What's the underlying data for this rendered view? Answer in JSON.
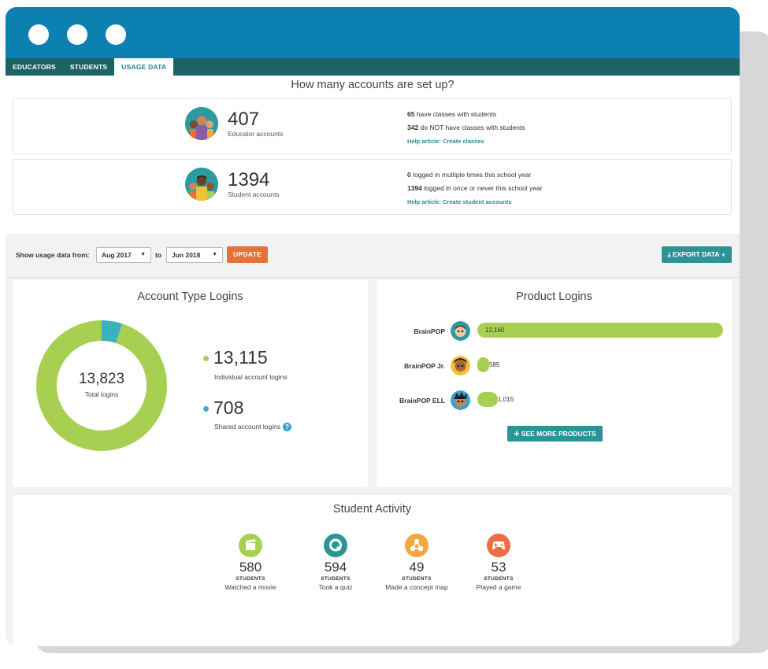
{
  "tabs": [
    {
      "label": "EDUCATORS"
    },
    {
      "label": "STUDENTS"
    },
    {
      "label": "USAGE DATA"
    }
  ],
  "accounts": {
    "title": "How many accounts are set up?",
    "educator": {
      "count": "407",
      "label": "Educator accounts",
      "line1_num": "65",
      "line1_text": " have classes with students",
      "line2_num": "342",
      "line2_text": " do NOT have classes with students",
      "help": "Help article: Create classes"
    },
    "student": {
      "count": "1394",
      "label": "Student accounts",
      "line1_num": "0",
      "line1_text": " logged in multiple times this school year",
      "line2_num": "1394",
      "line2_text": " logged in once or never this school year",
      "help": "Help article: Create student accounts"
    }
  },
  "filter": {
    "label": "Show usage data from:",
    "from": "Aug 2017",
    "to_label": "to",
    "to": "Jun 2018",
    "update": "UPDATE",
    "export": "EXPORT DATA"
  },
  "account_logins": {
    "title": "Account Type Logins",
    "total": "13,823",
    "total_label": "Total logins",
    "individual": "13,115",
    "individual_value": 13115,
    "individual_label": "Individual account logins",
    "shared": "708",
    "shared_value": 708,
    "shared_label": "Shared account logins",
    "colors": {
      "individual": "#a7cf52",
      "shared": "#3bb0bf"
    }
  },
  "product_logins": {
    "title": "Product Logins",
    "max": 12160,
    "items": [
      {
        "name": "BrainPOP",
        "value": 12160,
        "label": "12,160"
      },
      {
        "name": "BrainPOP Jr.",
        "value": 585,
        "label": "585"
      },
      {
        "name": "BrainPOP ELL",
        "value": 1015,
        "label": "1,015"
      }
    ],
    "more": "SEE MORE PRODUCTS"
  },
  "student_activity": {
    "title": "Student Activity",
    "unit": "STUDENTS",
    "items": [
      {
        "count": "580",
        "desc": "Watched a movie",
        "icon": "movie-icon",
        "color": "#a7cf52"
      },
      {
        "count": "594",
        "desc": "Took a quiz",
        "icon": "quiz-icon",
        "color": "#2c9496"
      },
      {
        "count": "49",
        "desc": "Made a concept map",
        "icon": "concept-map-icon",
        "color": "#f0a840"
      },
      {
        "count": "53",
        "desc": "Played a game",
        "icon": "game-icon",
        "color": "#ec6d45"
      }
    ]
  }
}
